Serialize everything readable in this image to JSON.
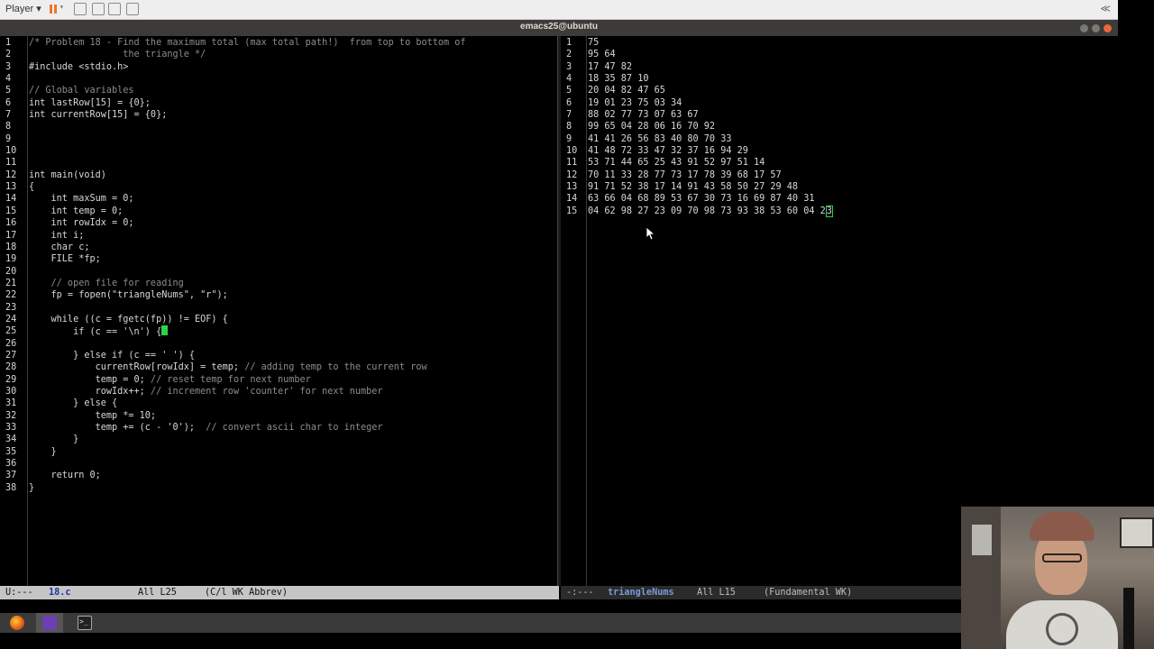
{
  "player_bar": {
    "menu_label": "Player",
    "collapse_label": "≪"
  },
  "window": {
    "title": "emacs25@ubuntu"
  },
  "left_buffer": {
    "lines": [
      {
        "n": "1",
        "segs": [
          {
            "t": "/* Problem 18 - Find the maximum total (max total path!)  from top to bottom of",
            "c": "c-comment"
          }
        ]
      },
      {
        "n": "2",
        "segs": [
          {
            "t": "                 the triangle */",
            "c": "c-comment"
          }
        ]
      },
      {
        "n": "3",
        "segs": [
          {
            "t": "#include <stdio.h>",
            "c": ""
          }
        ]
      },
      {
        "n": "4",
        "segs": []
      },
      {
        "n": "5",
        "segs": [
          {
            "t": "// Global variables",
            "c": "c-comment"
          }
        ]
      },
      {
        "n": "6",
        "segs": [
          {
            "t": "int lastRow[15] = {0};",
            "c": ""
          }
        ]
      },
      {
        "n": "7",
        "segs": [
          {
            "t": "int currentRow[15] = {0};",
            "c": ""
          }
        ]
      },
      {
        "n": "8",
        "segs": []
      },
      {
        "n": "9",
        "segs": []
      },
      {
        "n": "10",
        "segs": []
      },
      {
        "n": "11",
        "segs": []
      },
      {
        "n": "12",
        "segs": [
          {
            "t": "int main(void)",
            "c": ""
          }
        ]
      },
      {
        "n": "13",
        "segs": [
          {
            "t": "{",
            "c": ""
          }
        ]
      },
      {
        "n": "14",
        "segs": [
          {
            "t": "    int maxSum = 0;",
            "c": ""
          }
        ]
      },
      {
        "n": "15",
        "segs": [
          {
            "t": "    int temp = 0;",
            "c": ""
          }
        ]
      },
      {
        "n": "16",
        "segs": [
          {
            "t": "    int rowIdx = 0;",
            "c": ""
          }
        ]
      },
      {
        "n": "17",
        "segs": [
          {
            "t": "    int i;",
            "c": ""
          }
        ]
      },
      {
        "n": "18",
        "segs": [
          {
            "t": "    char c;",
            "c": ""
          }
        ]
      },
      {
        "n": "19",
        "segs": [
          {
            "t": "    FILE *fp;",
            "c": ""
          }
        ]
      },
      {
        "n": "20",
        "segs": []
      },
      {
        "n": "21",
        "segs": [
          {
            "t": "    // open file for reading",
            "c": "c-comment"
          }
        ]
      },
      {
        "n": "22",
        "segs": [
          {
            "t": "    fp = fopen(\"triangleNums\", \"r\");",
            "c": ""
          }
        ]
      },
      {
        "n": "23",
        "segs": []
      },
      {
        "n": "24",
        "segs": [
          {
            "t": "    while ((c = fgetc(fp)) != EOF) {",
            "c": ""
          }
        ]
      },
      {
        "n": "25",
        "segs": [
          {
            "t": "        if (c == '\\n') {",
            "c": ""
          }
        ],
        "cursor": true
      },
      {
        "n": "26",
        "segs": []
      },
      {
        "n": "27",
        "segs": [
          {
            "t": "        } else if (c == ' ') {",
            "c": ""
          }
        ]
      },
      {
        "n": "28",
        "segs": [
          {
            "t": "            currentRow[rowIdx] = temp; ",
            "c": ""
          },
          {
            "t": "// adding temp to the current row",
            "c": "c-comment"
          }
        ]
      },
      {
        "n": "29",
        "segs": [
          {
            "t": "            temp = 0; ",
            "c": ""
          },
          {
            "t": "// reset temp for next number",
            "c": "c-comment"
          }
        ]
      },
      {
        "n": "30",
        "segs": [
          {
            "t": "            rowIdx++; ",
            "c": ""
          },
          {
            "t": "// increment row 'counter' for next number",
            "c": "c-comment"
          }
        ]
      },
      {
        "n": "31",
        "segs": [
          {
            "t": "        } else {",
            "c": ""
          }
        ]
      },
      {
        "n": "32",
        "segs": [
          {
            "t": "            temp *= 10;",
            "c": ""
          }
        ]
      },
      {
        "n": "33",
        "segs": [
          {
            "t": "            temp += (c - '0');  ",
            "c": ""
          },
          {
            "t": "// convert ascii char to integer",
            "c": "c-comment"
          }
        ]
      },
      {
        "n": "34",
        "segs": [
          {
            "t": "        }",
            "c": ""
          }
        ]
      },
      {
        "n": "35",
        "segs": [
          {
            "t": "    }",
            "c": ""
          }
        ]
      },
      {
        "n": "36",
        "segs": []
      },
      {
        "n": "37",
        "segs": [
          {
            "t": "    return 0;",
            "c": ""
          }
        ]
      },
      {
        "n": "38",
        "segs": [
          {
            "t": "}",
            "c": ""
          }
        ]
      }
    ]
  },
  "right_buffer": {
    "lines": [
      {
        "n": "1",
        "t": "75"
      },
      {
        "n": "2",
        "t": "95 64"
      },
      {
        "n": "3",
        "t": "17 47 82"
      },
      {
        "n": "4",
        "t": "18 35 87 10"
      },
      {
        "n": "5",
        "t": "20 04 82 47 65"
      },
      {
        "n": "6",
        "t": "19 01 23 75 03 34"
      },
      {
        "n": "7",
        "t": "88 02 77 73 07 63 67"
      },
      {
        "n": "8",
        "t": "99 65 04 28 06 16 70 92"
      },
      {
        "n": "9",
        "t": "41 41 26 56 83 40 80 70 33"
      },
      {
        "n": "10",
        "t": "41 48 72 33 47 32 37 16 94 29"
      },
      {
        "n": "11",
        "t": "53 71 44 65 25 43 91 52 97 51 14"
      },
      {
        "n": "12",
        "t": "70 11 33 28 77 73 17 78 39 68 17 57"
      },
      {
        "n": "13",
        "t": "91 71 52 38 17 14 91 43 58 50 27 29 48"
      },
      {
        "n": "14",
        "t": "63 66 04 68 89 53 67 30 73 16 69 87 40 31"
      },
      {
        "n": "15",
        "t": "04 62 98 27 23 09 70 98 73 93 38 53 60 04 2",
        "cursor_char": "3"
      }
    ]
  },
  "modeline_left": {
    "status": "U:---",
    "buffer": "18.c",
    "position": "All L25",
    "mode": "(C/l WK Abbrev)"
  },
  "modeline_right": {
    "status": "-:---",
    "buffer": "triangleNums",
    "position": "All L15",
    "mode": "(Fundamental WK)"
  },
  "taskbar": {
    "items": [
      "firefox-icon",
      "emacs-icon",
      "terminal-icon"
    ]
  },
  "colors": {
    "cursor": "#2bd44b",
    "comment": "#8c8c8c",
    "text": "#d8d8d8",
    "modeline_active": "#c5c5c5",
    "modeline_inactive": "#2b2b2b"
  }
}
